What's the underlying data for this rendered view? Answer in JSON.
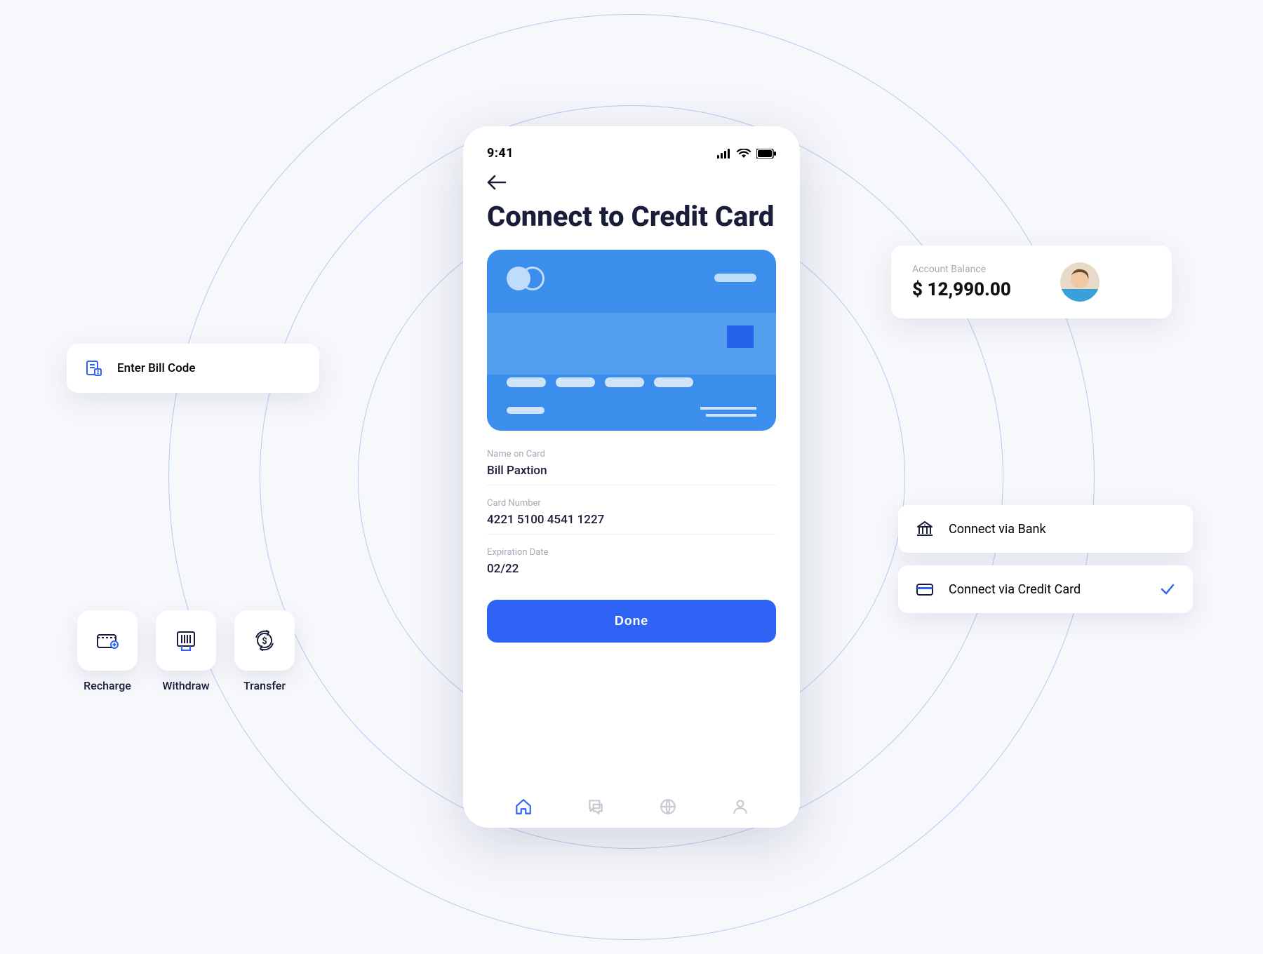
{
  "phone": {
    "time": "9:41",
    "title": "Connect to Credit Card",
    "fields": {
      "name_label": "Name on Card",
      "name_value": "Bill Paxtion",
      "number_label": "Card Number",
      "number_value": "4221 5100 4541 1227",
      "exp_label": "Expiration Date",
      "exp_value": "02/22"
    },
    "done_label": "Done"
  },
  "balance": {
    "label": "Account Balance",
    "value": "$ 12,990.00"
  },
  "connect": {
    "bank": "Connect via Bank",
    "card": "Connect via Credit Card"
  },
  "billcode": {
    "label": "Enter Bill Code"
  },
  "actions": {
    "recharge": "Recharge",
    "withdraw": "Withdraw",
    "transfer": "Transfer"
  }
}
